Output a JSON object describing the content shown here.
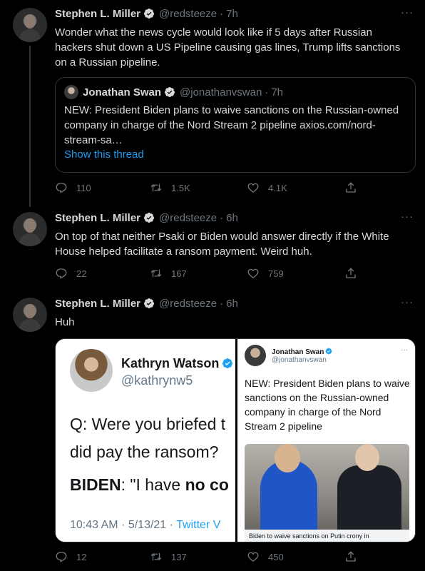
{
  "colors": {
    "background": "#000000",
    "text": "#d9d9d9",
    "muted": "#6e767d",
    "link": "#1d9bf0",
    "verified": "#d9d9d9"
  },
  "tweets": [
    {
      "name": "Stephen L. Miller",
      "handle": "@redsteeze",
      "dot": "·",
      "time": "7h",
      "more": "···",
      "text": "Wonder what the news cycle would look like if 5 days after Russian hackers shut down a US Pipeline causing gas lines, Trump lifts sanctions on a Russian pipeline.",
      "quote": {
        "name": "Jonathan Swan",
        "handle": "@jonathanvswan",
        "dot": "·",
        "time": "7h",
        "text": "NEW: President Biden plans to waive sanctions on the Russian-owned company in charge of the Nord Stream 2 pipeline axios.com/nord-stream-sa…",
        "link": "Show this thread"
      },
      "replies": "110",
      "retweets": "1.5K",
      "likes": "4.1K"
    },
    {
      "name": "Stephen L. Miller",
      "handle": "@redsteeze",
      "dot": "·",
      "time": "6h",
      "more": "···",
      "text": "On top of that neither Psaki or Biden would answer directly if the White House helped facilitate a ransom payment. Weird huh.",
      "replies": "22",
      "retweets": "167",
      "likes": "759"
    },
    {
      "name": "Stephen L. Miller",
      "handle": "@redsteeze",
      "dot": "·",
      "time": "6h",
      "more": "···",
      "text": "Huh",
      "media": {
        "left": {
          "name": "Kathryn Watson",
          "handle": "@kathrynw5",
          "line1": "Q: Were you briefed t",
          "line2": "did pay the ransom?",
          "line3_bold": "BIDEN",
          "line3_rest": ": \"I have ",
          "line3_bold2": "no co",
          "footer_time": "10:43 AM · 5/13/21 · ",
          "footer_source": "Twitter V"
        },
        "right": {
          "name": "Jonathan Swan",
          "handle": "@jonathanvswan",
          "more": "···",
          "text": "NEW: President Biden plans to waive sanctions on the Russian-owned company in charge of the Nord Stream 2 pipeline",
          "caption": "Biden to waive sanctions on Putin crony in"
        }
      },
      "replies": "12",
      "retweets": "137",
      "likes": "450"
    }
  ]
}
